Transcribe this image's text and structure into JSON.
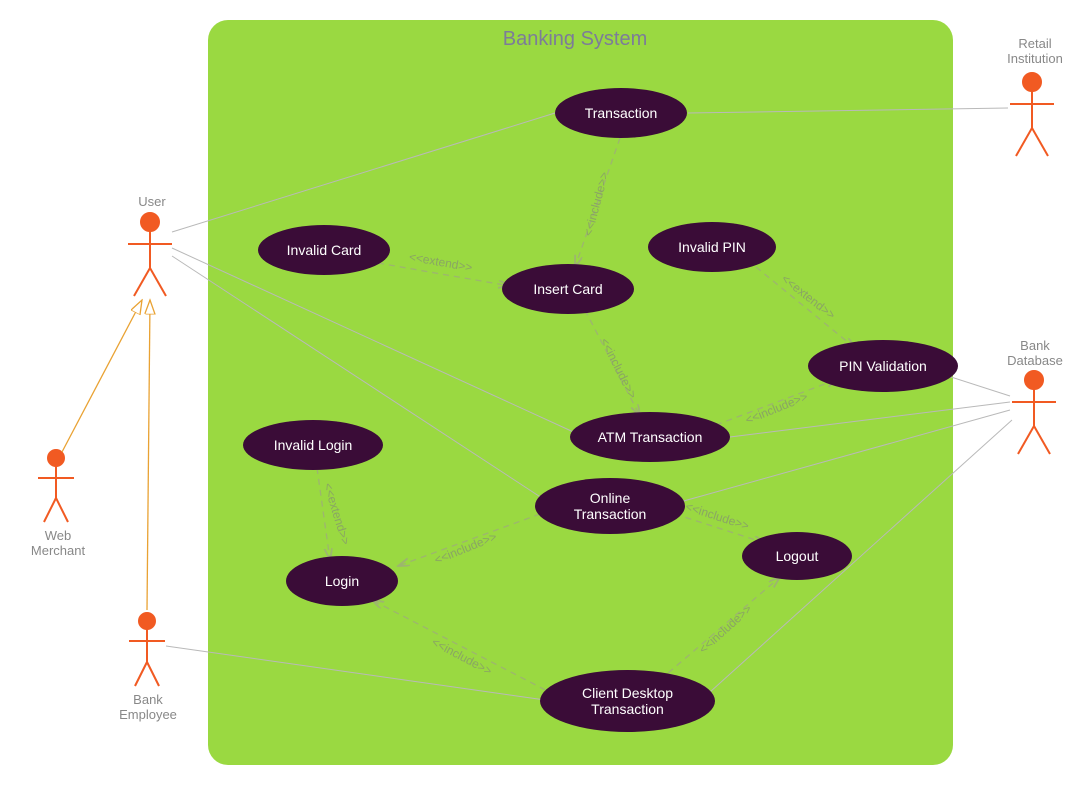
{
  "system": {
    "title": "Banking System"
  },
  "actors": {
    "user": "User",
    "web_merchant": "Web\nMerchant",
    "bank_employee": "Bank\nEmployee",
    "retail_institution": "Retail\nInstitution",
    "bank_database": "Bank\nDatabase"
  },
  "usecases": {
    "transaction": "Transaction",
    "invalid_card": "Invalid Card",
    "invalid_pin": "Invalid PIN",
    "insert_card": "Insert Card",
    "pin_validation": "PIN Validation",
    "invalid_login": "Invalid Login",
    "atm_transaction": "ATM Transaction",
    "online_transaction": "Online\nTransaction",
    "logout": "Logout",
    "login": "Login",
    "client_desktop_transaction": "Client Desktop\nTransaction"
  },
  "stereotypes": {
    "include": "<<include>>",
    "extend": "<<extend>>"
  },
  "relationships": [
    {
      "from": "transaction",
      "to": "insert_card",
      "type": "include"
    },
    {
      "from": "invalid_card",
      "to": "insert_card",
      "type": "extend"
    },
    {
      "from": "invalid_pin",
      "to": "pin_validation",
      "type": "extend"
    },
    {
      "from": "insert_card",
      "to": "atm_transaction",
      "type": "include"
    },
    {
      "from": "atm_transaction",
      "to": "pin_validation",
      "type": "include"
    },
    {
      "from": "invalid_login",
      "to": "login",
      "type": "extend"
    },
    {
      "from": "online_transaction",
      "to": "login",
      "type": "include"
    },
    {
      "from": "online_transaction",
      "to": "logout",
      "type": "include"
    },
    {
      "from": "client_desktop_transaction",
      "to": "login",
      "type": "include"
    },
    {
      "from": "client_desktop_transaction",
      "to": "logout",
      "type": "include"
    }
  ],
  "actor_links": [
    {
      "actor": "user",
      "usecase": "transaction"
    },
    {
      "actor": "user",
      "usecase": "atm_transaction"
    },
    {
      "actor": "user",
      "usecase": "online_transaction"
    },
    {
      "actor": "web_merchant",
      "generalizes_to": "user"
    },
    {
      "actor": "bank_employee",
      "generalizes_to": "user"
    },
    {
      "actor": "bank_employee",
      "usecase": "client_desktop_transaction"
    },
    {
      "actor": "retail_institution",
      "usecase": "transaction"
    },
    {
      "actor": "bank_database",
      "usecase": "pin_validation"
    },
    {
      "actor": "bank_database",
      "usecase": "atm_transaction"
    },
    {
      "actor": "bank_database",
      "usecase": "online_transaction"
    },
    {
      "actor": "bank_database",
      "usecase": "client_desktop_transaction"
    }
  ]
}
